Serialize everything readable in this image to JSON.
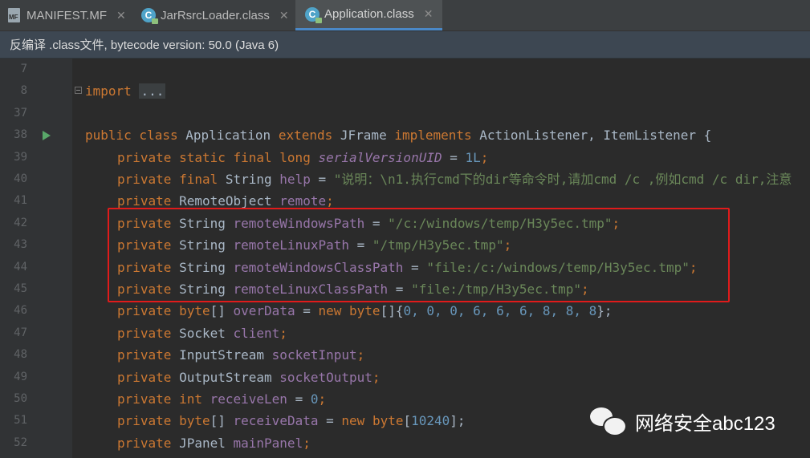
{
  "tabs": [
    {
      "label": "MANIFEST.MF",
      "icon": "manifest-file-icon",
      "icon_text": "MF",
      "close": "✕"
    },
    {
      "label": "JarRsrcLoader.class",
      "icon": "class-file-icon",
      "icon_text": "C",
      "close": "✕"
    },
    {
      "label": "Application.class",
      "icon": "class-file-icon",
      "icon_text": "C",
      "close": "✕",
      "active": true
    }
  ],
  "banner": {
    "text": "反编译 .class文件, bytecode version: 50.0 (Java 6)"
  },
  "lines": [
    {
      "num": "7"
    },
    {
      "num": "8"
    },
    {
      "num": "37"
    },
    {
      "num": "38"
    },
    {
      "num": "39"
    },
    {
      "num": "40"
    },
    {
      "num": "41"
    },
    {
      "num": "42"
    },
    {
      "num": "43"
    },
    {
      "num": "44"
    },
    {
      "num": "45"
    },
    {
      "num": "46"
    },
    {
      "num": "47"
    },
    {
      "num": "48"
    },
    {
      "num": "49"
    },
    {
      "num": "50"
    },
    {
      "num": "51"
    },
    {
      "num": "52"
    }
  ],
  "code": {
    "l8": {
      "kw": "import",
      "fold": "..."
    },
    "l38": {
      "t1": "public class",
      "t2": " Application ",
      "t3": "extends",
      "t4": " JFrame ",
      "t5": "implements",
      "t6": " ActionListener, ItemListener {"
    },
    "l39": {
      "kw": "private static final long",
      "name": "serialVersionUID",
      "eq": " = ",
      "val": "1L",
      "end": ";"
    },
    "l40": {
      "kw": "private final",
      "type": " String ",
      "name": "help",
      "eq": " = ",
      "val": "\"说明：\\n1.执行cmd下的dir等命令时,请加cmd /c ,例如cmd /c dir,注意"
    },
    "l41": {
      "kw": "private",
      "type": " RemoteObject ",
      "name": "remote",
      "end": ";"
    },
    "l42": {
      "kw": "private",
      "type": " String ",
      "name": "remoteWindowsPath",
      "eq": " = ",
      "val": "\"/c:/windows/temp/H3y5ec.tmp\"",
      "end": ";"
    },
    "l43": {
      "kw": "private",
      "type": " String ",
      "name": "remoteLinuxPath",
      "eq": " = ",
      "val": "\"/tmp/H3y5ec.tmp\"",
      "end": ";"
    },
    "l44": {
      "kw": "private",
      "type": " String ",
      "name": "remoteWindowsClassPath",
      "eq": " = ",
      "val": "\"file:/c:/windows/temp/H3y5ec.tmp\"",
      "end": ";"
    },
    "l45": {
      "kw": "private",
      "type": " String ",
      "name": "remoteLinuxClassPath",
      "eq": " = ",
      "val": "\"file:/tmp/H3y5ec.tmp\"",
      "end": ";"
    },
    "l46": {
      "kw": "private",
      "type1": " ",
      "kw2": "byte",
      "t2": "[] ",
      "name": "overData",
      "eq": " = ",
      "kw3": "new",
      "t3": " ",
      "kw4": "byte",
      "t4": "[]{",
      "nums": "0, 0, 0, 6, 6, 6, 8, 8, 8",
      "end": "};"
    },
    "l47": {
      "kw": "private",
      "type": " Socket ",
      "name": "client",
      "end": ";"
    },
    "l48": {
      "kw": "private",
      "type": " InputStream ",
      "name": "socketInput",
      "end": ";"
    },
    "l49": {
      "kw": "private",
      "type": " OutputStream ",
      "name": "socketOutput",
      "end": ";"
    },
    "l50": {
      "kw": "private int",
      "sp": " ",
      "name": "receiveLen",
      "eq": " = ",
      "val": "0",
      "end": ";"
    },
    "l51": {
      "kw": "private",
      "sp": " ",
      "kw2": "byte",
      "t2": "[] ",
      "name": "receiveData",
      "eq": " = ",
      "kw3": "new",
      "t3": " ",
      "kw4": "byte",
      "t4": "[",
      "val": "10240",
      "end": "];"
    },
    "l52": {
      "kw": "private",
      "type": " JPanel ",
      "name": "mainPanel",
      "end": ";"
    }
  },
  "watermark": {
    "text": "网络安全abc123",
    "icon": "wechat-icon"
  },
  "colors": {
    "keyword": "#cc7832",
    "field": "#9876aa",
    "string": "#6a8759",
    "number": "#6897bb",
    "highlight_box": "#e01b1b"
  }
}
